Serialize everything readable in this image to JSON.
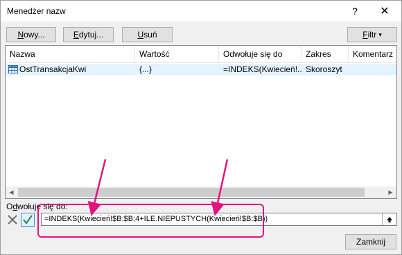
{
  "window": {
    "title": "Menedżer nazw",
    "help_glyph": "?",
    "close_glyph": "✕"
  },
  "toolbar": {
    "new_label_pre": "",
    "new_label_u": "N",
    "new_label_post": "owy...",
    "edit_label_pre": "",
    "edit_label_u": "E",
    "edit_label_post": "dytuj...",
    "delete_label_pre": "",
    "delete_label_u": "U",
    "delete_label_post": "suń",
    "filter_label_pre": "",
    "filter_label_u": "F",
    "filter_label_post": "iltr",
    "filter_arrow": "▾"
  },
  "table": {
    "columns": [
      "Nazwa",
      "Wartość",
      "Odwołuje się do",
      "Zakres",
      "Komentarz"
    ],
    "rows": [
      {
        "name": "OstTransakcjaKwi",
        "value": "{...}",
        "refers_to": "=INDEKS(Kwiecień!...",
        "scope": "Skoroszyt",
        "comment": ""
      }
    ]
  },
  "refers": {
    "label_pre": "O",
    "label_u": "d",
    "label_post": "wołuje się do:",
    "formula": "=INDEKS(Kwiecień!$B:$B;4+ILE.NIEPUSTYCH(Kwiecień!$B:$B))"
  },
  "footer": {
    "close_label": "Zamknij"
  },
  "colors": {
    "annotation": "#e0147e",
    "selected_row": "#e5f3ff"
  },
  "icons": {
    "name_icon": "table-grid-icon",
    "cancel_icon": "cancel-x-icon",
    "confirm_icon": "check-icon",
    "collapse_icon": "collapse-dialog-icon"
  }
}
